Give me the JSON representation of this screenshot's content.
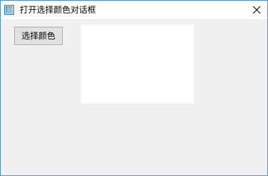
{
  "window": {
    "title": "打开选择颜色对话框",
    "close_icon": "close-icon",
    "app_icon": "dialog-app-icon"
  },
  "main": {
    "choose_color_label": "选择颜色",
    "preview_color": "#ffffff"
  },
  "colors": {
    "border": "#4a8fd6",
    "client_background": "#f0f0f0",
    "button_face": "#e1e1e1",
    "button_border": "#adadad"
  }
}
